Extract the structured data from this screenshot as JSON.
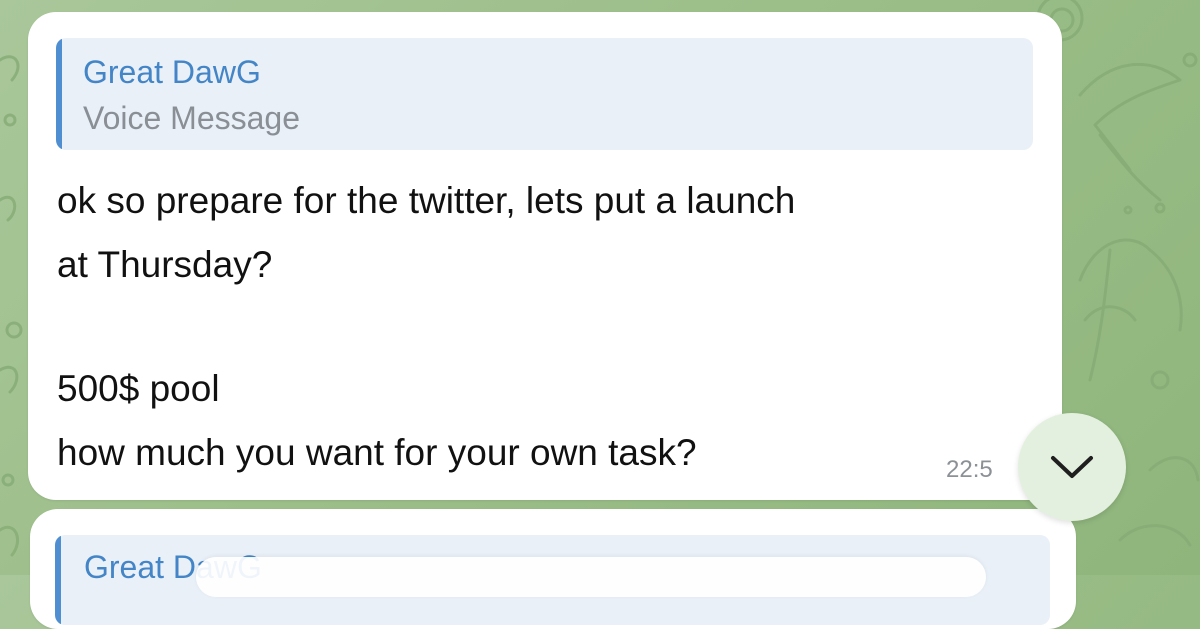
{
  "messages": [
    {
      "reply": {
        "author": "Great DawG",
        "kind": "Voice Message"
      },
      "lines": [
        "ok so prepare for the twitter, lets put a launch",
        "at Thursday?",
        "500$ pool",
        "how much you want for your own task?"
      ],
      "time": "22:5"
    },
    {
      "reply": {
        "author": "Great DawG"
      }
    }
  ],
  "controls": {
    "scroll_down_icon": "chevron-down-icon"
  },
  "colors": {
    "accent": "#4385c6",
    "quote_bar": "#4f8fd1",
    "bubble": "#ffffff",
    "wallpaper": "#9dbf8a"
  }
}
